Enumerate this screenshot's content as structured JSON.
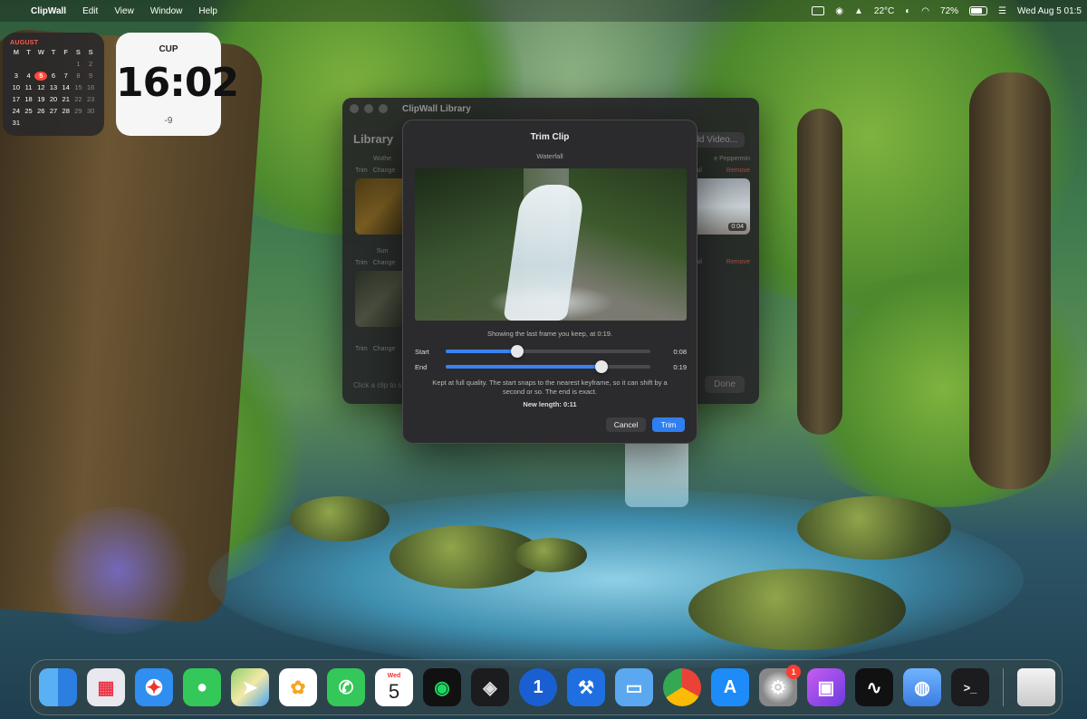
{
  "menubar": {
    "app_name": "ClipWall",
    "menus": [
      "Edit",
      "View",
      "Window",
      "Help"
    ],
    "weather": "22°C",
    "battery": "72%",
    "datetime": "Wed Aug 5  01:5"
  },
  "calendar_widget": {
    "month": "AUGUST",
    "weekdays": [
      "M",
      "T",
      "W",
      "T",
      "F",
      "S",
      "S"
    ],
    "weeks": [
      [
        "",
        "",
        "",
        "",
        "",
        "1",
        "2"
      ],
      [
        "3",
        "4",
        "5",
        "6",
        "7",
        "8",
        "9"
      ],
      [
        "10",
        "11",
        "12",
        "13",
        "14",
        "15",
        "16"
      ],
      [
        "17",
        "18",
        "19",
        "20",
        "21",
        "22",
        "23"
      ],
      [
        "24",
        "25",
        "26",
        "27",
        "28",
        "29",
        "30"
      ],
      [
        "31",
        "",
        "",
        "",
        "",
        "",
        ""
      ]
    ],
    "today": "5"
  },
  "clock_widget": {
    "city": "CUP",
    "time": "16:02",
    "offset": "-9"
  },
  "library_window": {
    "title": "ClipWall Library",
    "heading": "Library",
    "add_button": "dd Video...",
    "clips": [
      {
        "name": "Wuthe",
        "trim": "Trim",
        "change": "Change"
      },
      {
        "name": "Sun",
        "trim": "Trim",
        "change": "Change"
      },
      {
        "name": "",
        "trim": "Trim",
        "change": "Change"
      }
    ],
    "right_clips": [
      {
        "name": "e Peppermin",
        "thumbnail_label": "nail",
        "remove": "Remove",
        "duration": "0:04"
      },
      {
        "name": "",
        "thumbnail_label": "nail",
        "remove": "Remove",
        "duration": ""
      }
    ],
    "footer": "Click a clip to s",
    "done_button": "Done"
  },
  "trim_dialog": {
    "title": "Trim Clip",
    "clip_name": "Waterfall",
    "caption": "Showing the last frame you keep, at 0:19.",
    "start": {
      "label": "Start",
      "value": "0:08",
      "fraction": 0.35
    },
    "end": {
      "label": "End",
      "value": "0:19",
      "fraction": 0.76
    },
    "note": "Kept at full quality. The start snaps to the nearest keyframe, so it can shift by a second or so. The end is exact.",
    "new_length": "New length: 0:11",
    "cancel_button": "Cancel",
    "trim_button": "Trim",
    "accent_color": "#2f7ff0"
  },
  "dock": {
    "apps": [
      {
        "name": "Finder",
        "icon": "finder-icon"
      },
      {
        "name": "Launchpad",
        "icon": "launchpad-icon"
      },
      {
        "name": "Safari",
        "icon": "safari-icon"
      },
      {
        "name": "Messages",
        "icon": "messages-icon"
      },
      {
        "name": "Maps",
        "icon": "maps-icon"
      },
      {
        "name": "Photos",
        "icon": "photos-icon"
      },
      {
        "name": "Phone",
        "icon": "phone-icon"
      },
      {
        "name": "Calendar",
        "icon": "calendar-icon",
        "day": "Wed",
        "date": "5"
      },
      {
        "name": "Spotify",
        "icon": "spotify-icon"
      },
      {
        "name": "Unity",
        "icon": "cube-icon"
      },
      {
        "name": "1Password",
        "icon": "onepassword-icon"
      },
      {
        "name": "Xcode",
        "icon": "hammer-icon"
      },
      {
        "name": "Screens",
        "icon": "screens-icon"
      },
      {
        "name": "Chrome",
        "icon": "chrome-icon"
      },
      {
        "name": "App Store",
        "icon": "appstore-icon"
      },
      {
        "name": "System Settings",
        "icon": "settings-icon",
        "badge": "1"
      },
      {
        "name": "Codemonkey",
        "icon": "monitor-app-icon"
      },
      {
        "name": "Stocks",
        "icon": "stocks-icon"
      },
      {
        "name": "Simulator",
        "icon": "simulator-icon"
      },
      {
        "name": "Terminal",
        "icon": "terminal-icon",
        "glyph": ">_"
      }
    ],
    "trash": {
      "name": "Trash",
      "icon": "trash-icon"
    }
  }
}
